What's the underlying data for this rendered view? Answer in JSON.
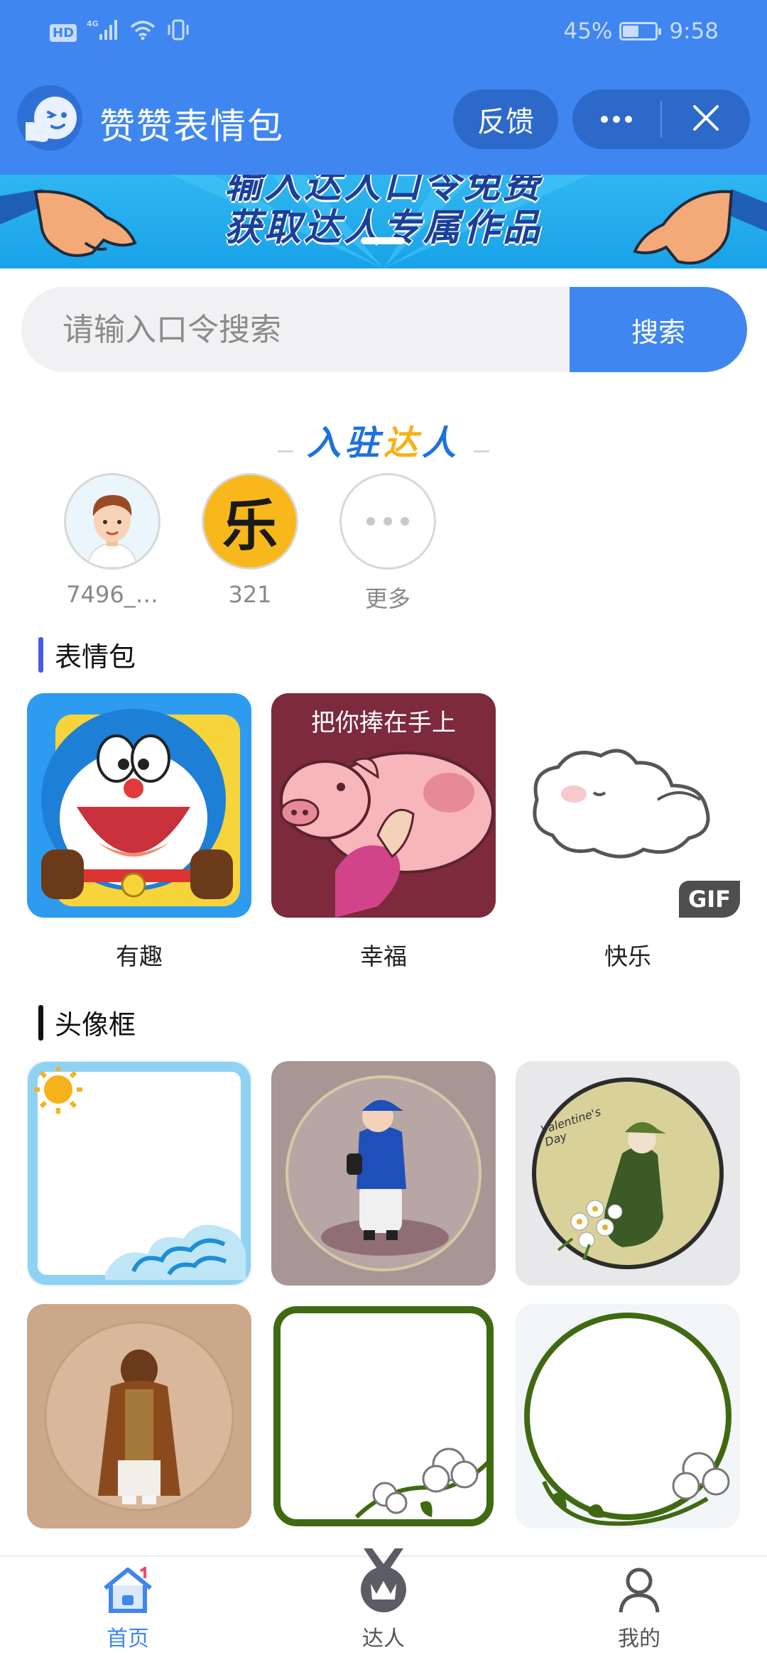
{
  "status_bar": {
    "network": "4G",
    "hd": "HD",
    "battery": "45%",
    "battery_level": 0.45,
    "time": "9:58"
  },
  "app_bar": {
    "title": "赞赞表情包",
    "feedback_label": "反馈",
    "more_icon": "more-dots-icon",
    "close_icon": "close-icon",
    "brand_color": "#3f86f0"
  },
  "banner": {
    "line1": "输入达人口令免费",
    "line2": "获取达人专属作品"
  },
  "search": {
    "placeholder": "请输入口令搜索",
    "value": "",
    "button_label": "搜索"
  },
  "experts": {
    "title_part1": "入驻",
    "title_part2": "达",
    "title_part3": "人",
    "items": [
      {
        "name": "7496_…"
      },
      {
        "name": "321",
        "avatar_text": "乐"
      },
      {
        "name": "更多"
      }
    ]
  },
  "stickers": {
    "heading": "表情包",
    "accent_color": "#4a5be0",
    "items": [
      {
        "label": "有趣"
      },
      {
        "label": "幸福",
        "caption": "把你捧在手上"
      },
      {
        "label": "快乐",
        "badge": "GIF"
      }
    ]
  },
  "frames": {
    "heading": "头像框",
    "accent_color": "#111111",
    "items": [
      {
        "name": "sky-wave-frame"
      },
      {
        "name": "blue-cap-boy-frame"
      },
      {
        "name": "valentines-day-frame",
        "caption": "Valentine's Day"
      },
      {
        "name": "brown-coat-frame"
      },
      {
        "name": "cotton-square-frame"
      },
      {
        "name": "cotton-circle-frame"
      }
    ]
  },
  "bottom_nav": {
    "items": [
      {
        "label": "首页",
        "icon": "home-icon",
        "active": true
      },
      {
        "label": "达人",
        "icon": "crown-medal-icon",
        "active": false
      },
      {
        "label": "我的",
        "icon": "user-icon",
        "active": false
      }
    ],
    "active_color": "#3f86f0",
    "inactive_color": "#555555"
  }
}
